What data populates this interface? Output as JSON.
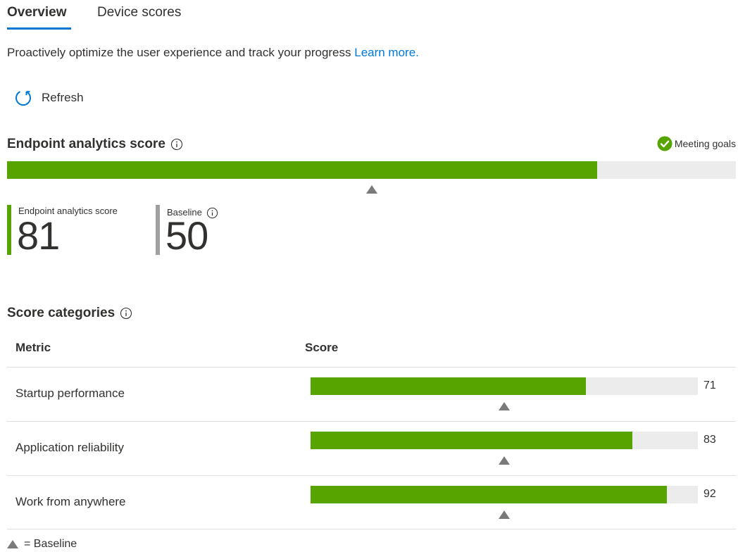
{
  "tabs": [
    {
      "label": "Overview",
      "active": true
    },
    {
      "label": "Device scores",
      "active": false
    }
  ],
  "description": {
    "text": "Proactively optimize the user experience and track your progress ",
    "link": "Learn more."
  },
  "toolbar": {
    "refresh_label": "Refresh",
    "refresh_icon": "refresh-icon"
  },
  "score_section": {
    "title": "Endpoint analytics score",
    "status": "Meeting goals",
    "score_fraction": 0.81,
    "baseline_fraction": 0.5
  },
  "kpis": {
    "score": {
      "label": "Endpoint analytics score",
      "value": "81"
    },
    "baseline": {
      "label": "Baseline",
      "value": "50"
    }
  },
  "categories": {
    "title": "Score categories",
    "headers": {
      "metric": "Metric",
      "score": "Score"
    },
    "rows": [
      {
        "metric": "Startup performance",
        "score": "71",
        "fraction": 0.71,
        "baseline_fraction": 0.5
      },
      {
        "metric": "Application reliability",
        "score": "83",
        "fraction": 0.83,
        "baseline_fraction": 0.5
      },
      {
        "metric": "Work from anywhere",
        "score": "92",
        "fraction": 0.92,
        "baseline_fraction": 0.5
      }
    ]
  },
  "legend": {
    "text": "= Baseline"
  },
  "colors": {
    "accent": "#0078d4",
    "good": "#57a300",
    "track": "#ececec",
    "baseline_marker": "#7a7a7a",
    "baseline_stripe": "#a19f9d"
  }
}
